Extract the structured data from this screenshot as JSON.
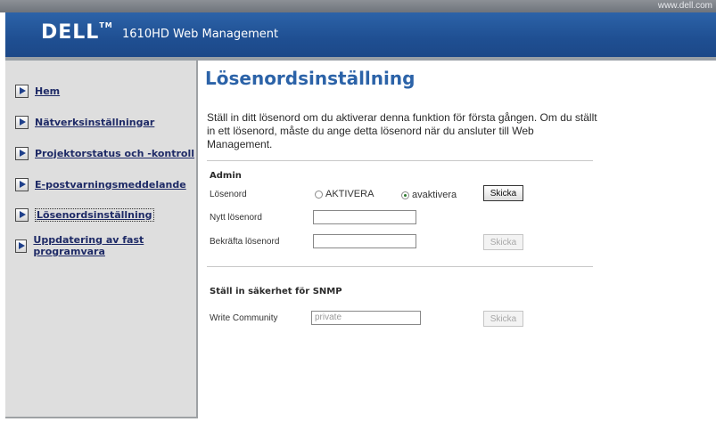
{
  "window": {
    "url": "www.dell.com"
  },
  "header": {
    "brand": "DELL",
    "brand_tm": "TM",
    "title": "1610HD Web Management"
  },
  "sidebar": {
    "items": [
      {
        "label": "Hem"
      },
      {
        "label": "Nätverksinställningar"
      },
      {
        "label": "Projektorstatus och -kontroll"
      },
      {
        "label": "E-postvarningsmeddelande"
      },
      {
        "label": "Lösenordsinställning",
        "active": true
      },
      {
        "label": "Uppdatering av fast programvara"
      }
    ]
  },
  "main": {
    "title": "Lösenordsinställning",
    "intro": "Ställ in ditt lösenord om du aktiverar denna funktion för första gången. Om du ställt in ett lösenord, måste du ange detta lösenord när du ansluter till Web Management.",
    "admin": {
      "section_title": "Admin",
      "password_label": "Lösenord",
      "radio_enable": "AKTIVERA",
      "radio_disable": "avaktivera",
      "selected": "avaktivera",
      "submit_label": "Skicka",
      "new_password_label": "Nytt lösenord",
      "new_password_value": "",
      "confirm_label": "Bekräfta lösenord",
      "confirm_value": "",
      "submit2_label": "Skicka"
    },
    "snmp": {
      "section_title": "Ställ in säkerhet för SNMP",
      "community_label": "Write Community",
      "community_value": "private",
      "submit_label": "Skicka"
    }
  }
}
